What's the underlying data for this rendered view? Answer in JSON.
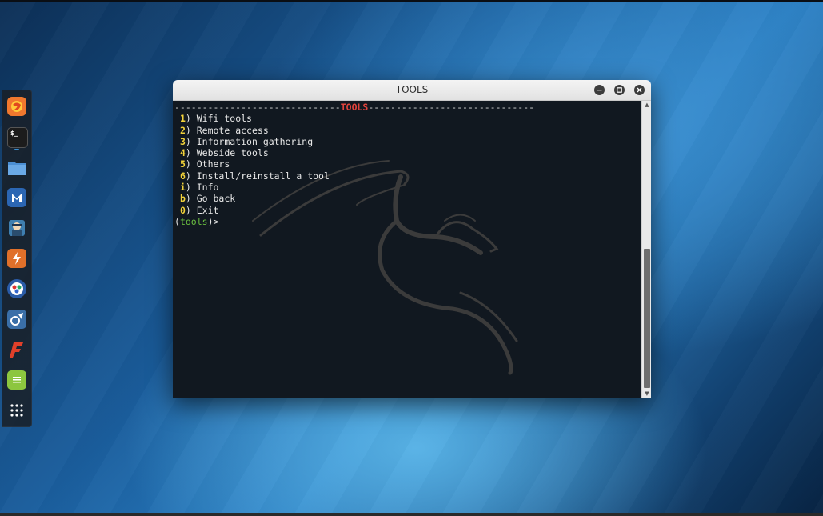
{
  "window": {
    "title": "TOOLS"
  },
  "terminal": {
    "sep_left": "------------------------------",
    "header": "TOOLS",
    "sep_right": "------------------------------",
    "menu": [
      {
        "key": "1",
        "label": "Wifi tools"
      },
      {
        "key": "2",
        "label": "Remote access"
      },
      {
        "key": "3",
        "label": "Information gathering"
      },
      {
        "key": "4",
        "label": "Webside tools"
      },
      {
        "key": "5",
        "label": "Others"
      },
      {
        "key": "6",
        "label": "Install/reinstall a tool"
      },
      {
        "key": "i",
        "label": "Info"
      },
      {
        "key": "b",
        "label": "Go back"
      },
      {
        "key": "0",
        "label": "Exit"
      }
    ],
    "prompt_open": "(",
    "prompt_name": "tools",
    "prompt_close": ")>"
  },
  "dock": {
    "apps": [
      {
        "icon": "firefox-icon",
        "color": "#f0782e"
      },
      {
        "icon": "terminal-icon",
        "color": "#1c1c1c"
      },
      {
        "icon": "files-icon",
        "color": "#3b7fc4"
      },
      {
        "icon": "metasploit-icon",
        "color": "#2b66b3"
      },
      {
        "icon": "armitage-icon",
        "color": "#4a8cb8"
      },
      {
        "icon": "burpsuite-icon",
        "color": "#e0702a"
      },
      {
        "icon": "maltego-icon",
        "color": "#2a5ca8"
      },
      {
        "icon": "beef-icon",
        "color": "#3a6fa8"
      },
      {
        "icon": "faraday-icon",
        "color": "#d83a2a"
      },
      {
        "icon": "text-editor-icon",
        "color": "#8cc63f"
      },
      {
        "icon": "show-apps-icon",
        "color": "#ffffff"
      }
    ]
  }
}
